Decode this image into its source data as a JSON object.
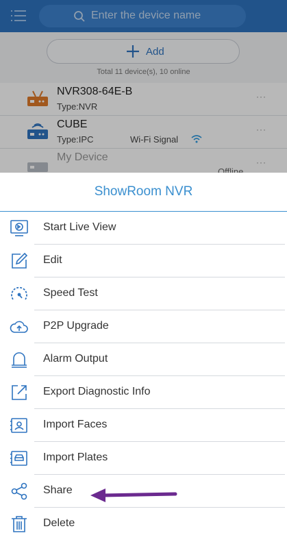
{
  "header": {
    "search_placeholder": "Enter the device name",
    "menu_icon": "hamburger-menu-icon",
    "search_icon": "search-icon"
  },
  "device_list": {
    "add_label": "Add",
    "total_text": "Total 11 device(s), 10 online",
    "devices": [
      {
        "name": "NVR308-64E-B",
        "type": "Type:NVR",
        "extra": "",
        "status": "",
        "more": "···"
      },
      {
        "name": "CUBE",
        "type": "Type:IPC",
        "extra": "Wi-Fi Signal",
        "status": "",
        "more": "···"
      },
      {
        "name": "My Device",
        "type": "",
        "extra": "",
        "status": "Offline",
        "more": "···"
      }
    ]
  },
  "action_sheet": {
    "title": "ShowRoom NVR",
    "items": [
      {
        "label": "Start Live View",
        "icon": "live-view-icon"
      },
      {
        "label": "Edit",
        "icon": "edit-icon"
      },
      {
        "label": "Speed Test",
        "icon": "speed-test-icon"
      },
      {
        "label": "P2P Upgrade",
        "icon": "cloud-upload-icon"
      },
      {
        "label": "Alarm Output",
        "icon": "alarm-bell-icon"
      },
      {
        "label": "Export Diagnostic Info",
        "icon": "export-icon"
      },
      {
        "label": "Import Faces",
        "icon": "face-card-icon"
      },
      {
        "label": "Import Plates",
        "icon": "car-plate-icon"
      },
      {
        "label": "Share",
        "icon": "share-icon"
      },
      {
        "label": "Delete",
        "icon": "trash-icon"
      }
    ]
  },
  "colors": {
    "header_blue": "#2f74c0",
    "accent_blue": "#3a8fcf",
    "nvr_orange": "#e07b2a",
    "annotation_purple": "#6b2a8f"
  }
}
